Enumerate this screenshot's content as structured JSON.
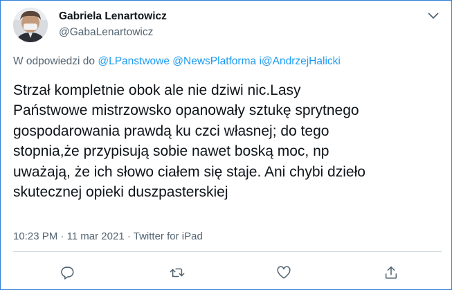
{
  "author": {
    "name": "Gabriela Lenartowicz",
    "handle": "@GabaLenartowicz"
  },
  "reply": {
    "prefix": "W odpowiedzi do",
    "mention_1": "@LPanstwowe",
    "mention_2": "@NewsPlatforma",
    "connector": "i",
    "mention_3": "@AndrzejHalicki"
  },
  "tweet": {
    "text": "Strzał kompletnie obok ale nie dziwi nic.Lasy\nPaństwowe mistrzowsko opanowały sztukę sprytnego\ngospodarowania prawdą ku czci własnej; do tego\nstopnia,że przypisują sobie nawet boską moc, np\nuważają, że ich słowo ciałem się staje. Ani chybi dzieło\nskutecznej opieki duszpasterskiej"
  },
  "meta": {
    "time": "10:23 PM",
    "separator_1": "·",
    "date": "11 mar 2021",
    "separator_2": "·",
    "source": "Twitter for iPad"
  },
  "icons": {
    "more": "chevron-down-icon",
    "reply": "reply-icon",
    "retweet": "retweet-icon",
    "like": "heart-icon",
    "share": "share-icon"
  },
  "colors": {
    "frame_border": "#2f80d8",
    "mention": "#1d9bf0",
    "secondary_text": "#536471",
    "primary_text": "#0f1419"
  }
}
